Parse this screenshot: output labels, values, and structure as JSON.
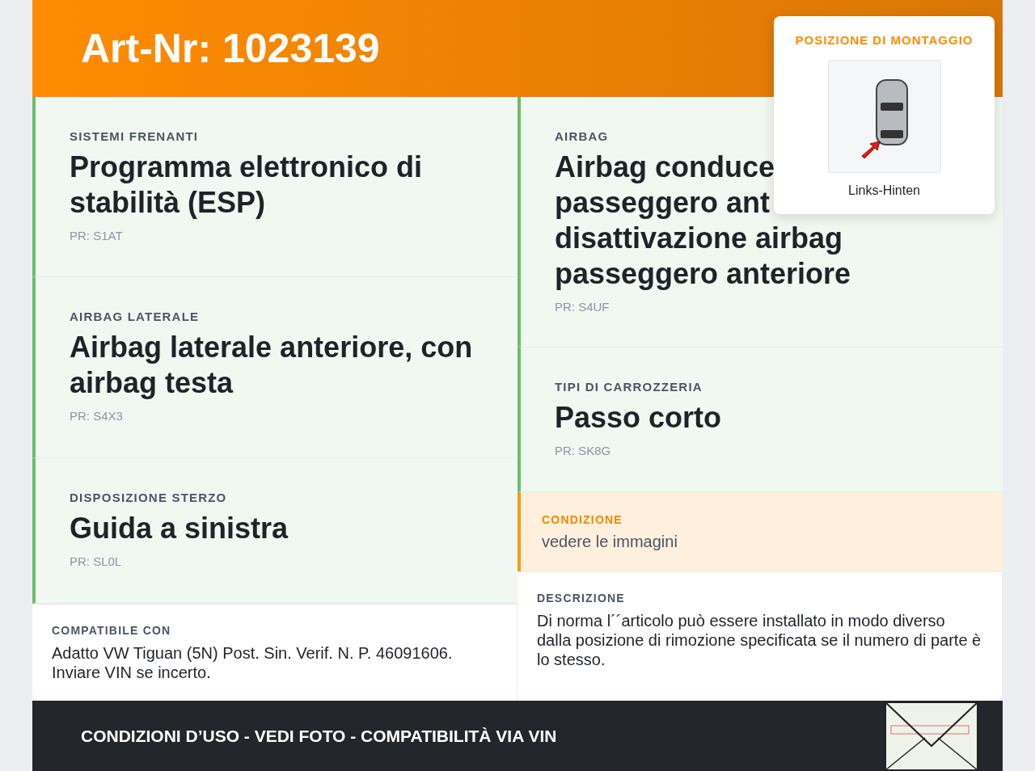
{
  "header": {
    "title": "Art-Nr: 1023139"
  },
  "mounting_position": {
    "heading": "POSIZIONE DI MONTAGGIO",
    "label": "Links-Hinten"
  },
  "left_features": [
    {
      "category": "SISTEMI FRENANTI",
      "title_lines": [
        "Programma elettronico di",
        "stabilità (ESP)"
      ],
      "pr": "PR: S1AT"
    },
    {
      "category": "AIRBAG LATERALE",
      "title_lines": [
        "Airbag laterale anteriore, con",
        "airbag testa"
      ],
      "pr": "PR: S4X3"
    },
    {
      "category": "DISPOSIZIONE STERZO",
      "title_lines": [
        "Guida a sinistra"
      ],
      "pr": "PR: SL0L"
    }
  ],
  "right_features": [
    {
      "category": "AIRBAG",
      "title_lines": [
        "Airbag conduce",
        "passeggero ant",
        "disattivazione airbag",
        "passeggero anteriore"
      ],
      "pr": "PR: S4UF"
    },
    {
      "category": "TIPI DI CARROZZERIA",
      "title_lines": [
        "Passo corto"
      ],
      "pr": "PR: SK8G"
    }
  ],
  "condition": {
    "label": "CONDIZIONE",
    "value": "vedere le immagini"
  },
  "compatibility": {
    "label": "COMPATIBILE CON",
    "text": "Adatto VW Tiguan (5N) Post. Sin. Verif. N. P. 46091606. Inviare VIN se incerto."
  },
  "description": {
    "label": "DESCRIZIONE",
    "text": "Di norma l´´articolo può essere installato in modo diverso dalla posizione di rimozione specificata se il numero di parte è lo stesso."
  },
  "footer": {
    "text": "CONDIZIONI D’USO - VEDI FOTO - COMPATIBILITÀ VIA VIN"
  }
}
